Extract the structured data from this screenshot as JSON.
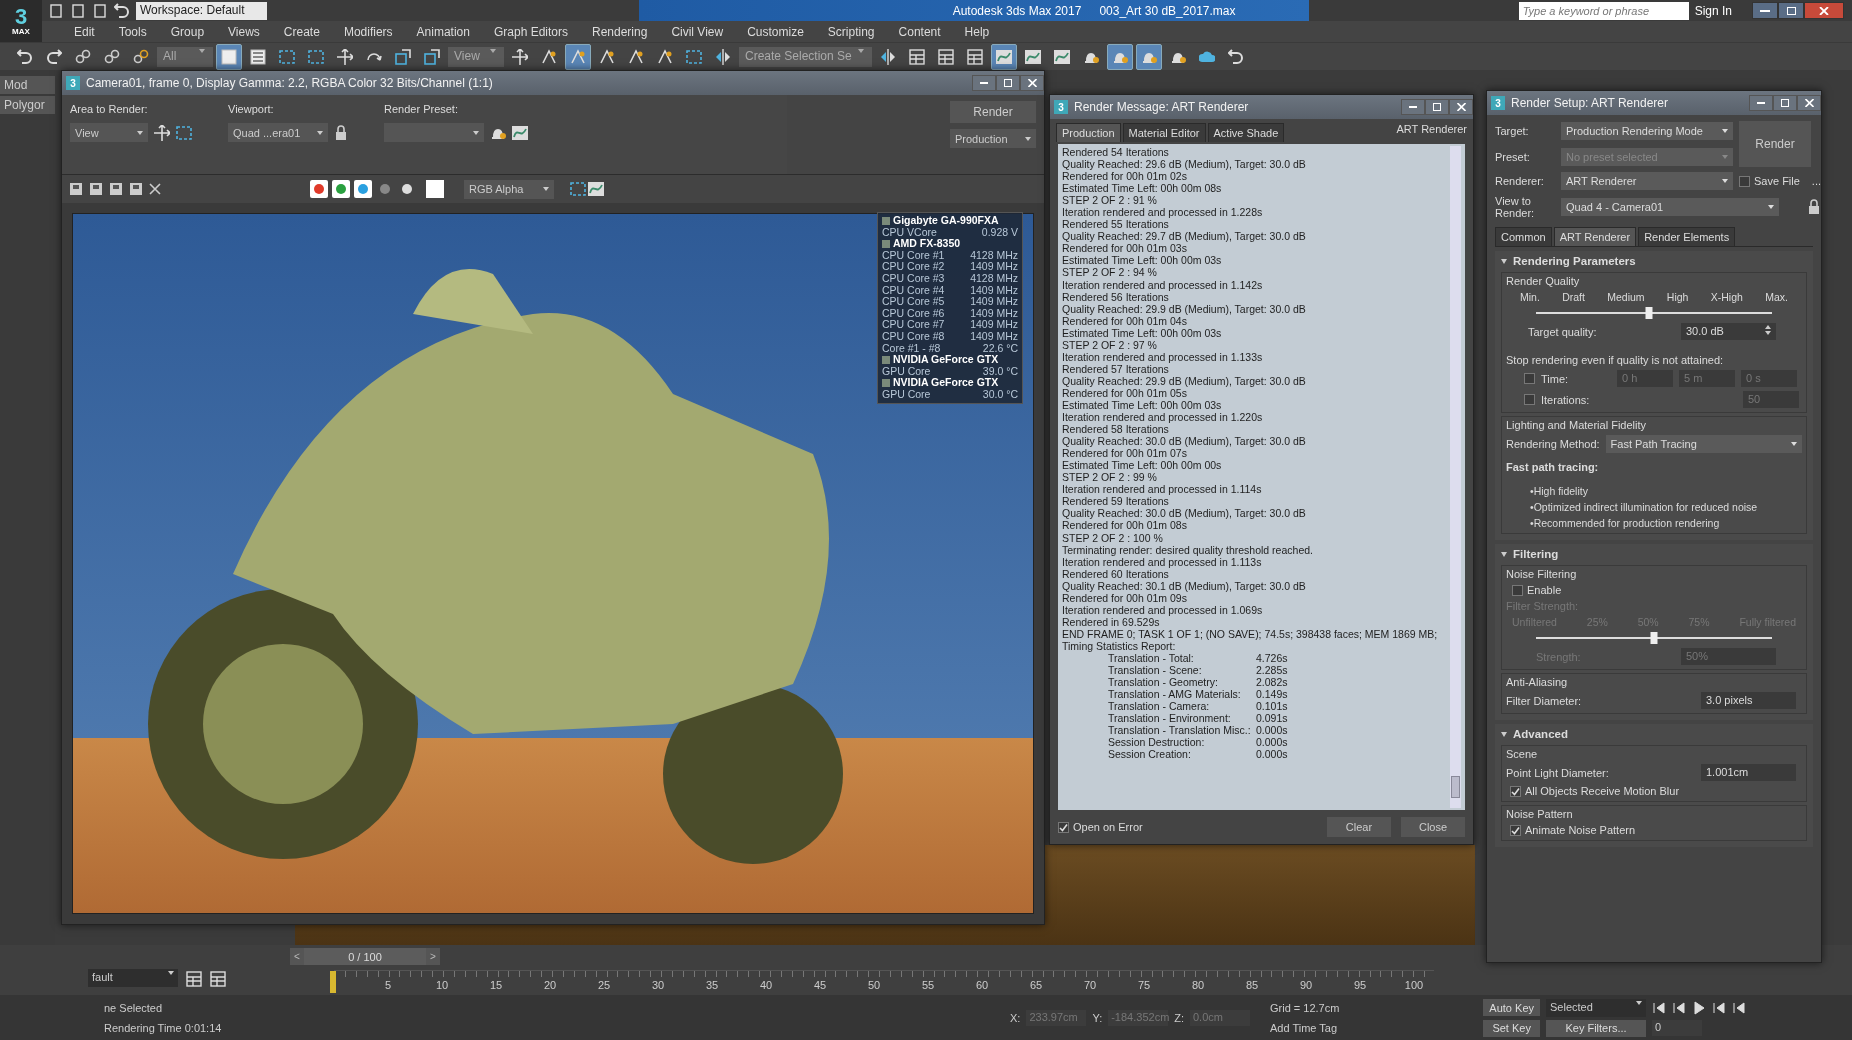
{
  "app": {
    "logo": "3",
    "logo_sub": "MAX",
    "workspace": "Workspace: Default",
    "title": "Autodesk 3ds Max 2017",
    "file": "003_Art 30 dB_2017.max",
    "search_placeholder": "Type a keyword or phrase",
    "sign_in": "Sign In"
  },
  "menu": [
    "Edit",
    "Tools",
    "Group",
    "Views",
    "Create",
    "Modifiers",
    "Animation",
    "Graph Editors",
    "Rendering",
    "Civil View",
    "Customize",
    "Scripting",
    "Content",
    "Help"
  ],
  "toolbar": [
    {
      "kind": "button",
      "selected": false
    },
    {
      "kind": "button",
      "selected": false
    },
    {
      "kind": "button",
      "selected": false
    },
    {
      "kind": "button",
      "selected": false
    },
    {
      "kind": "button",
      "selected": false
    },
    {
      "kind": "dropdown",
      "value": "All"
    },
    {
      "kind": "button",
      "selected": true
    },
    {
      "kind": "button",
      "selected": false
    },
    {
      "kind": "button",
      "selected": false
    },
    {
      "kind": "button",
      "selected": false
    },
    {
      "kind": "button",
      "selected": false
    },
    {
      "kind": "button",
      "selected": false
    },
    {
      "kind": "button",
      "selected": false
    },
    {
      "kind": "button",
      "selected": false
    },
    {
      "kind": "dropdown",
      "value": "View"
    },
    {
      "kind": "button",
      "selected": false
    },
    {
      "kind": "button",
      "selected": false
    },
    {
      "kind": "button",
      "selected": true
    },
    {
      "kind": "button",
      "selected": false
    },
    {
      "kind": "button",
      "selected": false
    },
    {
      "kind": "button",
      "selected": false
    },
    {
      "kind": "button",
      "selected": false
    },
    {
      "kind": "button",
      "selected": false
    },
    {
      "kind": "dropdown",
      "value": "Create Selection Se"
    },
    {
      "kind": "button",
      "selected": false
    },
    {
      "kind": "button",
      "selected": false
    },
    {
      "kind": "button",
      "selected": false
    },
    {
      "kind": "button",
      "selected": false
    },
    {
      "kind": "button",
      "selected": true
    },
    {
      "kind": "button",
      "selected": false
    },
    {
      "kind": "button",
      "selected": false
    },
    {
      "kind": "button",
      "selected": false
    },
    {
      "kind": "button",
      "selected": true
    },
    {
      "kind": "button",
      "selected": true
    },
    {
      "kind": "button",
      "selected": false
    },
    {
      "kind": "button",
      "selected": false
    },
    {
      "kind": "button",
      "selected": false
    }
  ],
  "command_panel": {
    "tabs": [
      "Mod",
      "Polygor"
    ]
  },
  "frame_window": {
    "icon": "3",
    "title": "Camera01, frame 0, Display Gamma: 2.2, RGBA Color 32 Bits/Channel (1:1)",
    "area_label": "Area to Render:",
    "area_value": "View",
    "viewport_label": "Viewport:",
    "viewport_value": "Quad ...era01",
    "preset_label": "Render Preset:",
    "render_button": "Render",
    "render_mode": "Production",
    "channels": [
      {
        "kind": "red",
        "selected": true
      },
      {
        "kind": "green",
        "selected": true
      },
      {
        "kind": "blue",
        "selected": true
      },
      {
        "kind": "mono",
        "selected": false
      },
      {
        "kind": "alpha",
        "selected": false
      }
    ],
    "display_channel": "RGB Alpha",
    "monitor": [
      {
        "name": "Gigabyte GA-990FXA",
        "rows": [
          {
            "label": "CPU VCore",
            "value": "0.928 V"
          }
        ]
      },
      {
        "name": "AMD FX-8350",
        "rows": [
          {
            "label": "CPU Core #1",
            "value": "4128 MHz"
          },
          {
            "label": "CPU Core #2",
            "value": "1409 MHz"
          },
          {
            "label": "CPU Core #3",
            "value": "4128 MHz"
          },
          {
            "label": "CPU Core #4",
            "value": "1409 MHz"
          },
          {
            "label": "CPU Core #5",
            "value": "1409 MHz"
          },
          {
            "label": "CPU Core #6",
            "value": "1409 MHz"
          },
          {
            "label": "CPU Core #7",
            "value": "1409 MHz"
          },
          {
            "label": "CPU Core #8",
            "value": "1409 MHz"
          },
          {
            "label": "Core #1 - #8",
            "value": "22.6 °C"
          }
        ]
      },
      {
        "name": "NVIDIA GeForce GTX",
        "rows": [
          {
            "label": "GPU Core",
            "value": "39.0 °C"
          }
        ]
      },
      {
        "name": "NVIDIA GeForce GTX",
        "rows": [
          {
            "label": "GPU Core",
            "value": "30.0 °C"
          }
        ]
      }
    ]
  },
  "render_message": {
    "icon": "3",
    "title": "Render Message: ART Renderer",
    "tabs": [
      {
        "label": "Production",
        "selected": true
      },
      {
        "label": "Material Editor",
        "selected": false
      },
      {
        "label": "Active Shade",
        "selected": false
      }
    ],
    "renderer": "ART Renderer",
    "log": [
      "Rendered 54 Iterations",
      "Quality Reached: 29.6 dB (Medium), Target: 30.0 dB",
      "Rendered for 00h 01m 02s",
      "Estimated Time Left: 00h 00m 08s",
      "STEP 2 OF 2 : 91 %",
      "Iteration rendered and processed in 1.228s",
      "Rendered 55 Iterations",
      "Quality Reached: 29.7 dB (Medium), Target: 30.0 dB",
      "Rendered for 00h 01m 03s",
      "Estimated Time Left: 00h 00m 03s",
      "STEP 2 OF 2 : 94 %",
      "Iteration rendered and processed in 1.142s",
      "Rendered 56 Iterations",
      "Quality Reached: 29.9 dB (Medium), Target: 30.0 dB",
      "Rendered for 00h 01m 04s",
      "Estimated Time Left: 00h 00m 03s",
      "STEP 2 OF 2 : 97 %",
      "Iteration rendered and processed in 1.133s",
      "Rendered 57 Iterations",
      "Quality Reached: 29.9 dB (Medium), Target: 30.0 dB",
      "Rendered for 00h 01m 05s",
      "Estimated Time Left: 00h 00m 03s",
      "Iteration rendered and processed in 1.220s",
      "Rendered 58 Iterations",
      "Quality Reached: 30.0 dB (Medium), Target: 30.0 dB",
      "Rendered for 00h 01m 07s",
      "Estimated Time Left: 00h 00m 00s",
      "STEP 2 OF 2 : 99 %",
      "Iteration rendered and processed in 1.114s",
      "Rendered 59 Iterations",
      "Quality Reached: 30.0 dB (Medium), Target: 30.0 dB",
      "Rendered for 00h 01m 08s",
      "STEP 2 OF 2 : 100 %",
      "Terminating render: desired quality threshold reached.",
      "Iteration rendered and processed in 1.113s",
      "Rendered 60 Iterations",
      "Quality Reached: 30.1 dB (Medium), Target: 30.0 dB",
      "Rendered for 00h 01m 09s",
      "Iteration rendered and processed in 1.069s",
      "Rendered in 69.529s",
      "END FRAME 0; TASK 1 OF 1; (NO SAVE); 74.5s; 398438 faces; MEM 1869 MB;",
      "Timing Statistics Report:"
    ],
    "timing": [
      {
        "label": "Translation - Total:",
        "value": "4.726s"
      },
      {
        "label": "Translation - Scene:",
        "value": "2.285s"
      },
      {
        "label": "Translation - Geometry:",
        "value": "2.082s"
      },
      {
        "label": "Translation - AMG Materials:",
        "value": "0.149s"
      },
      {
        "label": "Translation - Camera:",
        "value": "0.101s"
      },
      {
        "label": "Translation - Environment:",
        "value": "0.091s"
      },
      {
        "label": "Translation - Translation Misc.:",
        "value": "0.000s"
      },
      {
        "label": "Session Destruction:",
        "value": "0.000s"
      },
      {
        "label": "Session Creation:",
        "value": "0.000s"
      }
    ],
    "open_on_error": {
      "label": "Open on Error",
      "checked": true
    },
    "buttons": [
      "Clear",
      "Close"
    ]
  },
  "render_setup": {
    "icon": "3",
    "title": "Render Setup: ART Renderer",
    "fields": [
      {
        "label": "Target:",
        "value": "Production Rendering Mode",
        "disabled": false
      },
      {
        "label": "Preset:",
        "value": "No preset selected",
        "disabled": true
      },
      {
        "label": "Renderer:",
        "value": "ART Renderer",
        "disabled": false
      }
    ],
    "render_button": "Render",
    "save_file": {
      "label": "Save File",
      "checked": false
    },
    "more": "...",
    "view_label": "View to Render:",
    "view_value": "Quad 4 - Camera01",
    "tabs": [
      {
        "label": "Common",
        "selected": false
      },
      {
        "label": "ART Renderer",
        "selected": true
      },
      {
        "label": "Render Elements",
        "selected": false
      }
    ],
    "rendering_parameters": {
      "title": "Rendering Parameters",
      "expanded": true,
      "quality_title": "Render Quality",
      "ticks": [
        "Min.",
        "Draft",
        "Medium",
        "High",
        "X-High",
        "Max."
      ],
      "level": 0.48,
      "target_label": "Target quality:",
      "target_value": "30.0 dB",
      "stop_title": "Stop rendering even if quality is not attained:",
      "time": {
        "label": "Time:",
        "checked": false,
        "values": [
          "0 h",
          "5 m",
          "0 s"
        ]
      },
      "iterations": {
        "label": "Iterations:",
        "checked": false,
        "value": "50"
      },
      "fidelity_title": "Lighting and Material Fidelity",
      "method_label": "Rendering Method:",
      "method": "Fast Path Tracing",
      "heading": "Fast path tracing:",
      "bullets": [
        "•High fidelity",
        "•Optimized indirect illumination for reduced noise",
        "•Recommended for production rendering"
      ]
    },
    "filtering": {
      "title": "Filtering",
      "expanded": true,
      "noise_title": "Noise Filtering",
      "enable": {
        "label": "Enable",
        "checked": false
      },
      "strength_title": "Filter Strength:",
      "ticks": [
        "Unfiltered",
        "25%",
        "50%",
        "75%",
        "Fully filtered"
      ],
      "level": 0.5,
      "strength_label": "Strength:",
      "strength_value": "50%",
      "aa_title": "Anti-Aliasing",
      "diameter_label": "Filter Diameter:",
      "diameter_value": "3.0 pixels"
    },
    "advanced": {
      "title": "Advanced",
      "expanded": true,
      "scene_title": "Scene",
      "light_label": "Point Light Diameter:",
      "light_value": "1.001cm",
      "motion_blur": {
        "label": "All Objects Receive Motion Blur",
        "checked": true
      },
      "noise_title": "Noise Pattern",
      "animate": {
        "label": "Animate Noise Pattern",
        "checked": true
      }
    }
  },
  "timeline": {
    "layer": "fault",
    "slider": {
      "value": "0 / 100",
      "level": 0,
      "prev": "<",
      "next": ">"
    },
    "ticks": [
      "5",
      "10",
      "15",
      "20",
      "25",
      "30",
      "35",
      "40",
      "45",
      "50",
      "55",
      "60",
      "65",
      "70",
      "75",
      "80",
      "85",
      "90",
      "95",
      "100"
    ]
  },
  "status_bar": {
    "selection": "ne Selected",
    "render_time": "Rendering Time  0:01:14",
    "x": "233.97cm",
    "y": "-184.352cm",
    "z": "0.0cm",
    "x_label": "X:",
    "y_label": "Y:",
    "z_label": "Z:",
    "grid": "Grid = 12.7cm",
    "time_tag": "Add Time Tag",
    "auto_key": "Auto Key",
    "set_key": "Set Key",
    "key_mode": "Selected",
    "key_filters": "Key Filters...",
    "frame": "0"
  }
}
